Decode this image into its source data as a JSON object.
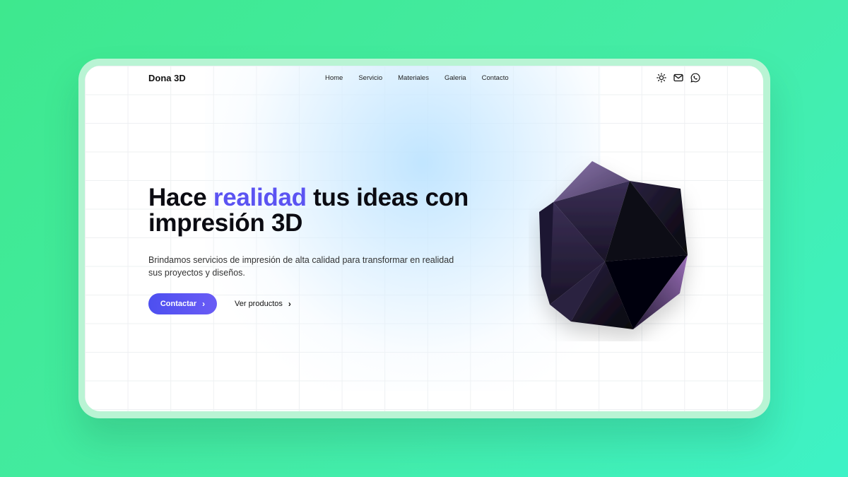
{
  "brand": {
    "name": "Dona 3D"
  },
  "nav": {
    "items": [
      "Home",
      "Servicio",
      "Materiales",
      "Galeria",
      "Contacto"
    ],
    "icons": [
      "sun-icon",
      "mail-icon",
      "whatsapp-icon"
    ]
  },
  "hero": {
    "headline_part1": "Hace ",
    "headline_highlight": "realidad",
    "headline_part2": " tus ideas con impresión 3D",
    "subtext": "Brindamos servicios de impresión de alta calidad para transformar en realidad sus proyectos y diseños.",
    "primary_button": "Contactar",
    "secondary_button": "Ver productos",
    "chevron": "›"
  },
  "colors": {
    "accent": "#5b53f2",
    "background_green": "#3ee88e",
    "shape_dark": "#15111f",
    "shape_purple": "#7a6497"
  }
}
